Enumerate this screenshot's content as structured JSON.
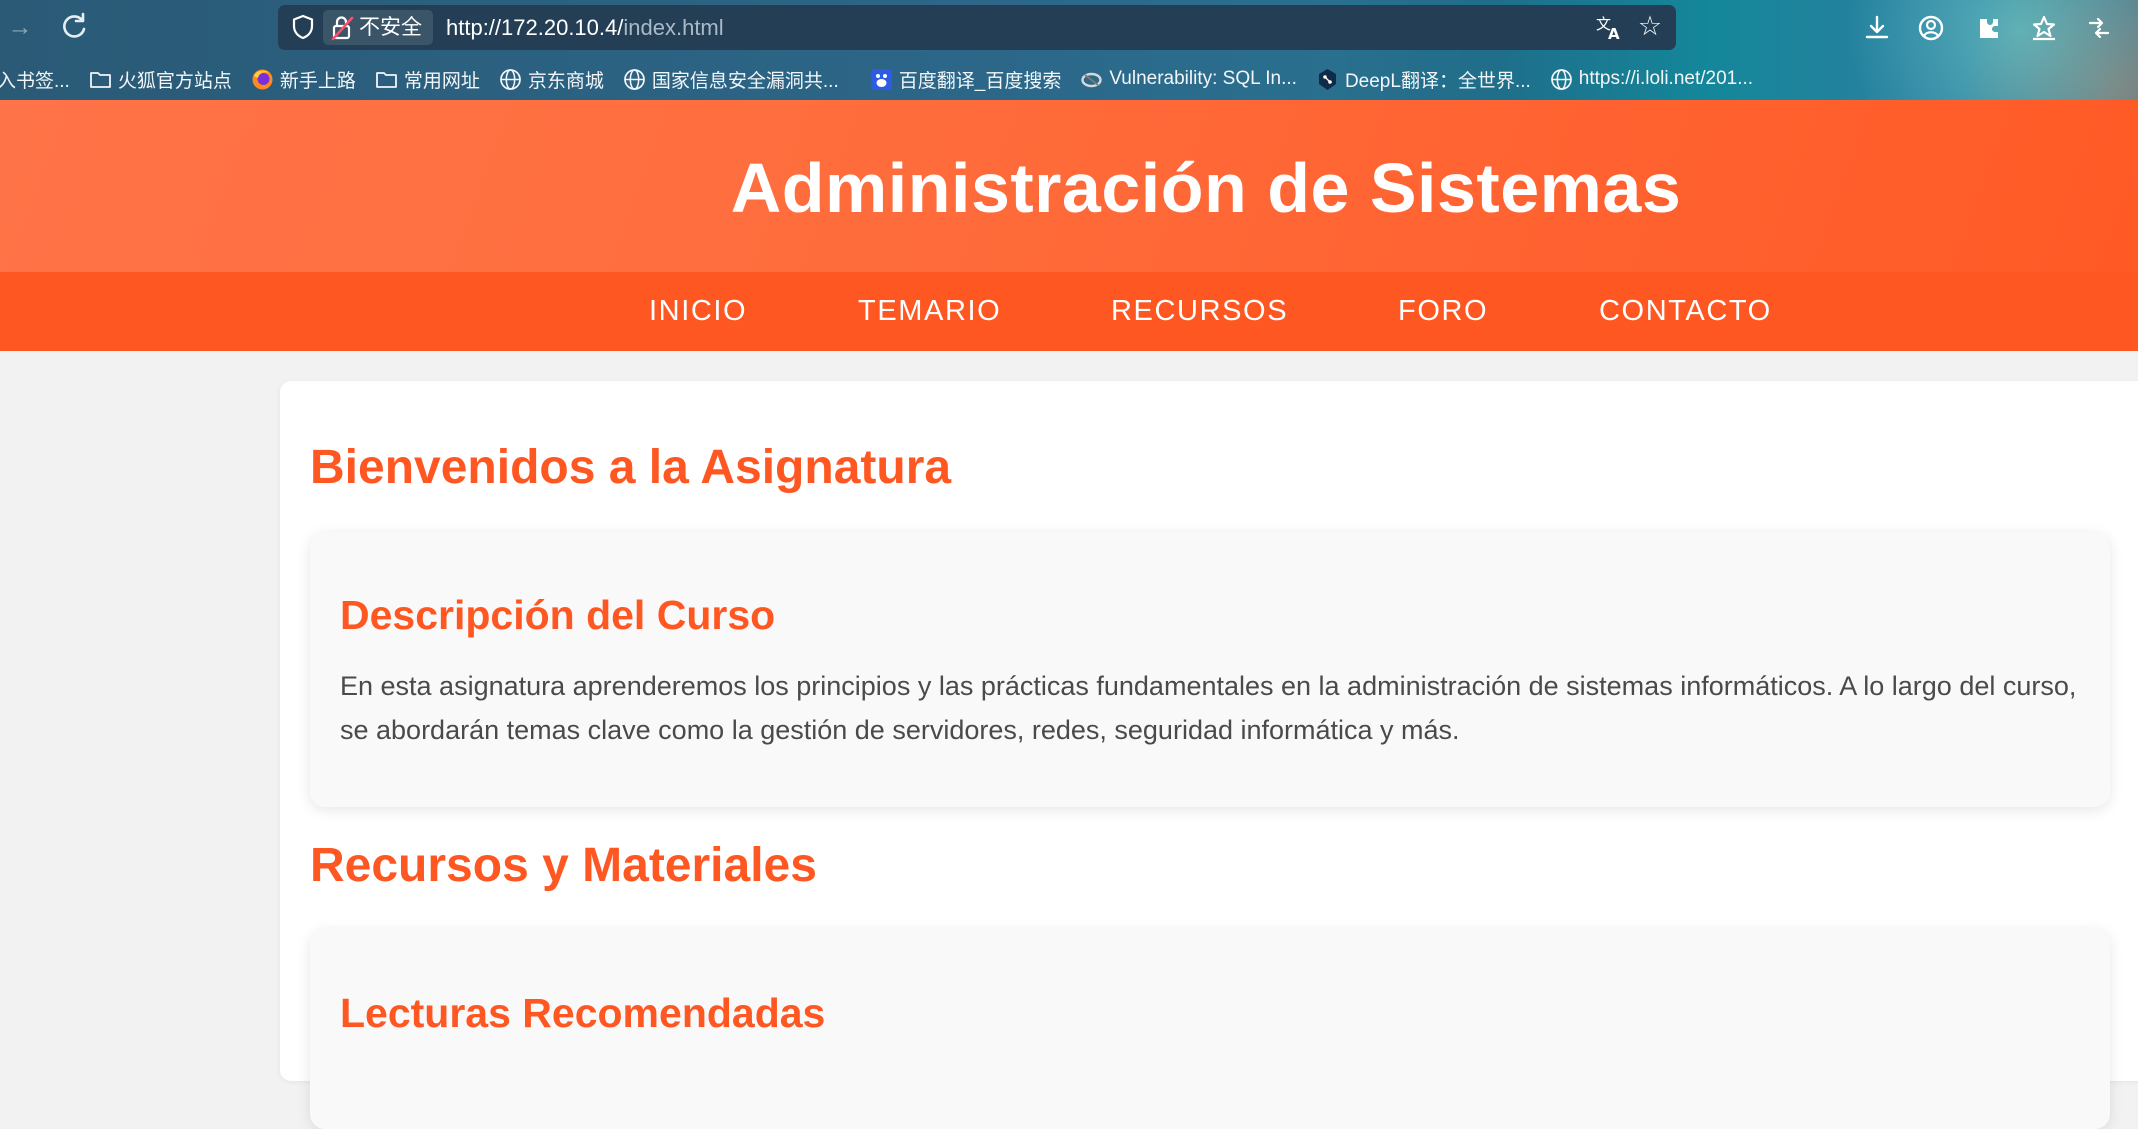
{
  "browser": {
    "insecure_label": "不安全",
    "url_host": "http://172.20.10.4/",
    "url_path": "index.html",
    "icons": [
      "forward-icon",
      "reload-icon",
      "shield-icon",
      "lock-icon",
      "translate-icon",
      "star-icon",
      "download-icon",
      "account-icon",
      "extension-icon",
      "bookmark-star-icon",
      "sync-icon"
    ]
  },
  "bookmarks": [
    {
      "label": "入书签...",
      "icon": "none"
    },
    {
      "label": "火狐官方站点",
      "icon": "folder-icon"
    },
    {
      "label": "新手上路",
      "icon": "firefox-icon"
    },
    {
      "label": "常用网址",
      "icon": "folder-icon"
    },
    {
      "label": "京东商城",
      "icon": "globe-icon"
    },
    {
      "label": "国家信息安全漏洞共...",
      "icon": "globe-icon"
    },
    {
      "label": "百度翻译_百度搜索",
      "icon": "baidu-icon"
    },
    {
      "label": "Vulnerability: SQL In...",
      "icon": "dvwa-icon"
    },
    {
      "label": "DeepL翻译：全世界...",
      "icon": "deepl-icon"
    },
    {
      "label": "https://i.loli.net/201...",
      "icon": "globe-icon"
    }
  ],
  "site": {
    "title": "Administración de Sistemas",
    "nav": [
      "INICIO",
      "TEMARIO",
      "RECURSOS",
      "FORO",
      "CONTACTO"
    ],
    "welcome_heading": "Bienvenidos a la Asignatura",
    "description_heading": "Descripción del Curso",
    "description_text": "En esta asignatura aprenderemos los principios y las prácticas fundamentales en la administración de sistemas informáticos. A lo largo del curso, se abordarán temas clave como la gestión de servidores, redes, seguridad informática y más.",
    "resources_heading": "Recursos y Materiales",
    "readings_heading": "Lecturas Recomendadas"
  },
  "colors": {
    "accent": "#ff5722",
    "header_gradient_start": "#ff7348",
    "page_background": "#f2f2f2",
    "card_background": "#f9f9f9",
    "body_text": "#4a4a4a"
  }
}
